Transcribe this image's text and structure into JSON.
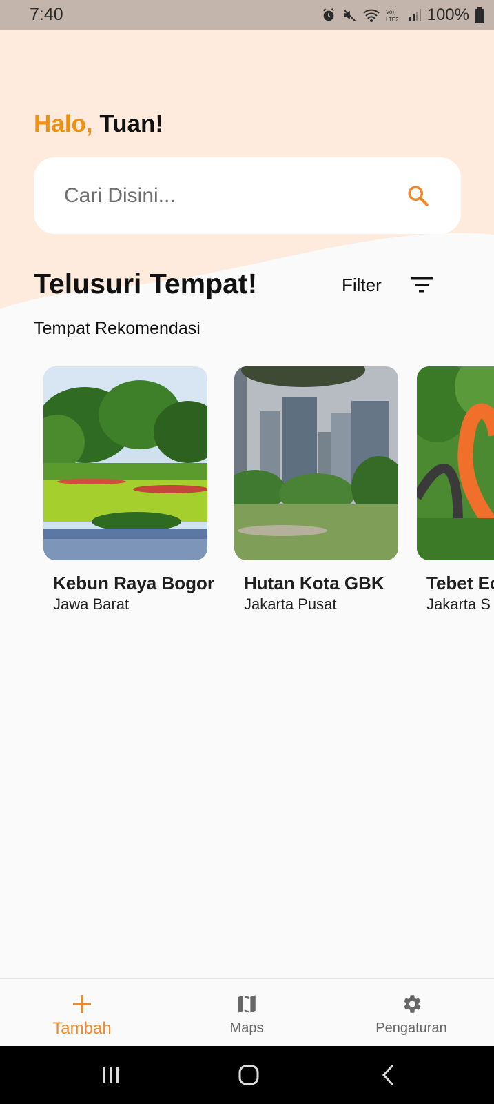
{
  "status_bar": {
    "time": "7:40",
    "battery": "100%"
  },
  "header": {
    "greeting_prefix": "Halo,",
    "greeting_name": "Tuan!",
    "search_placeholder": "Cari Disini..."
  },
  "section": {
    "title": "Telusuri Tempat!",
    "filter_label": "Filter",
    "subtitle": "Tempat Rekomendasi"
  },
  "places": [
    {
      "name": "Kebun Raya Bogor",
      "region": "Jawa Barat"
    },
    {
      "name": "Hutan Kota GBK",
      "region": "Jakarta Pusat"
    },
    {
      "name": "Tebet Ec",
      "region": "Jakarta S"
    }
  ],
  "bottom_nav": [
    {
      "label": "Tambah",
      "icon": "plus-icon",
      "active": true
    },
    {
      "label": "Maps",
      "icon": "map-icon",
      "active": false
    },
    {
      "label": "Pengaturan",
      "icon": "gear-icon",
      "active": false
    }
  ],
  "colors": {
    "accent": "#ef8a2c",
    "header_bg": "#ffebde",
    "status_bar": "#c3b5ab"
  }
}
